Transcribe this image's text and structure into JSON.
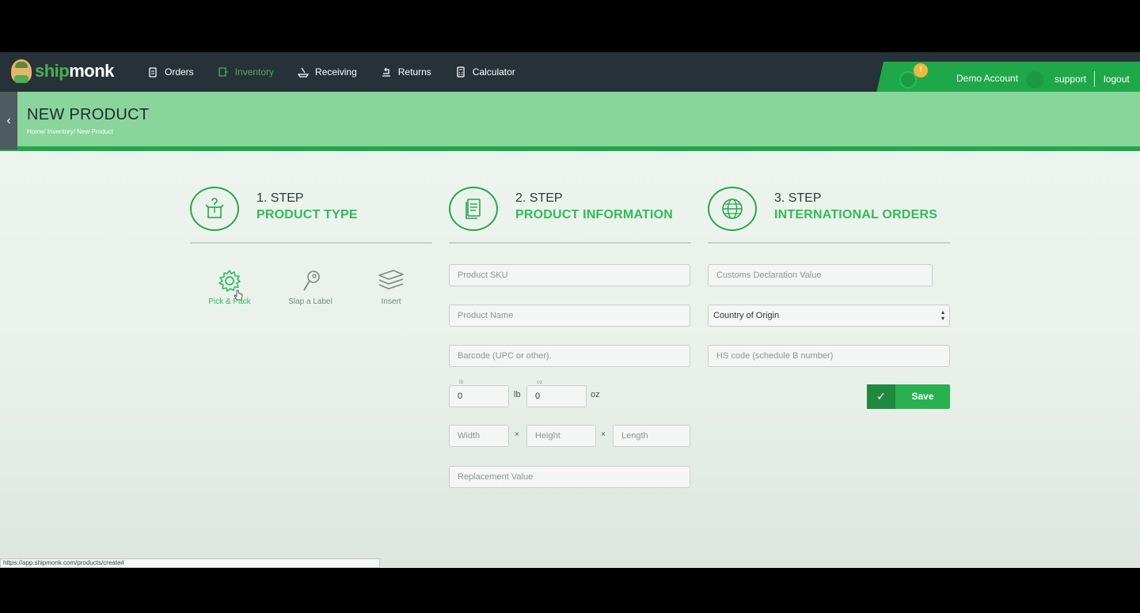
{
  "app": {
    "logo_ship": "ship",
    "logo_monk": "monk"
  },
  "nav": {
    "items": [
      {
        "label": "Orders",
        "icon": "clipboard-icon",
        "active": false
      },
      {
        "label": "Inventory",
        "icon": "inventory-icon",
        "active": true
      },
      {
        "label": "Receiving",
        "icon": "receiving-icon",
        "active": false
      },
      {
        "label": "Returns",
        "icon": "returns-icon",
        "active": false
      },
      {
        "label": "Calculator",
        "icon": "calculator-icon",
        "active": false
      }
    ]
  },
  "account": {
    "badge": "!",
    "name": "Demo Account",
    "support": "support",
    "logout": "logout"
  },
  "header": {
    "title": "NEW PRODUCT",
    "breadcrumb": "Home/ Inventory/ New Product"
  },
  "steps": [
    {
      "num": "1. STEP",
      "title": "PRODUCT TYPE",
      "icon": "box-question-icon"
    },
    {
      "num": "2. STEP",
      "title": "PRODUCT INFORMATION",
      "icon": "document-icon"
    },
    {
      "num": "3. STEP",
      "title": "INTERNATIONAL ORDERS",
      "icon": "globe-icon"
    }
  ],
  "product_types": [
    {
      "label": "Pick & Pack",
      "icon": "gear-icon",
      "active": true
    },
    {
      "label": "Slap a Label",
      "icon": "label-tag-icon",
      "active": false
    },
    {
      "label": "Insert",
      "icon": "layers-icon",
      "active": false
    }
  ],
  "product_info": {
    "sku_placeholder": "Product SKU",
    "name_placeholder": "Product Name",
    "barcode_placeholder": "Barcode (UPC or other).",
    "lb_micro": "lb",
    "lb_value": "0",
    "lb_unit": "lb",
    "oz_micro": "oz",
    "oz_value": "0",
    "oz_unit": "oz",
    "width_placeholder": "Width",
    "height_placeholder": "Height",
    "length_placeholder": "Length",
    "times": "×",
    "replacement_placeholder": "Replacement Value"
  },
  "international": {
    "customs_placeholder": "Customs Declaration Value",
    "country_selected": "Country of Origin",
    "hs_placeholder": "HS code (schedule B number)"
  },
  "save_label": "Save",
  "status_url": "https://app.shipmonk.com/products/create#",
  "colors": {
    "brand_green": "#27b24f",
    "nav_dark": "#263238",
    "band_green": "#8ad59b"
  }
}
